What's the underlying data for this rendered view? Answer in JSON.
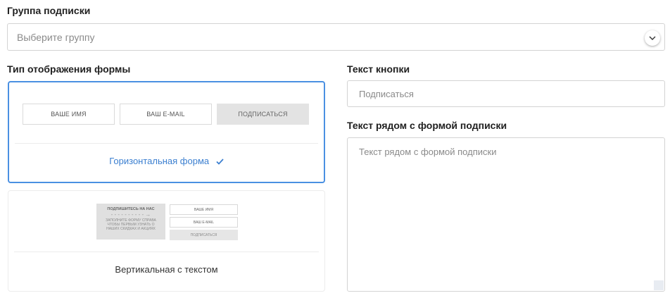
{
  "subscription_group": {
    "label": "Группа подписки",
    "placeholder": "Выберите группу"
  },
  "form_display": {
    "label": "Тип отображения формы",
    "options": [
      {
        "caption": "Горизонтальная форма",
        "selected": true,
        "preview": {
          "name": "ВАШЕ ИМЯ",
          "email": "ВАШ E-MAIL",
          "button": "ПОДПИСАТЬСЯ"
        }
      },
      {
        "caption": "Вертикальная с текстом",
        "selected": false,
        "preview": {
          "heading": "ПОДПИШИТЕСЬ НА НАС",
          "arrow": "- - - - - - - - - - →",
          "body": "ЗАПОЛНИТЕ ФОРМУ СПРАВА ЧТОБЫ ПЕРВЫМ УЗНАТЬ О НАШИХ СКИДКАХ И АКЦИЯХ",
          "name": "ВАШЕ ИМЯ",
          "email": "ВАШ E-MAIL",
          "button": "ПОДПИСАТЬСЯ"
        }
      }
    ]
  },
  "button_text": {
    "label": "Текст кнопки",
    "placeholder": "Подписаться"
  },
  "side_text": {
    "label": "Текст рядом с формой подписки",
    "placeholder": "Текст рядом с формой подписки"
  },
  "icons": {
    "dropdown": "chevron-down-icon",
    "selected": "checkmark-icon"
  },
  "colors": {
    "accent": "#4a90e2"
  }
}
